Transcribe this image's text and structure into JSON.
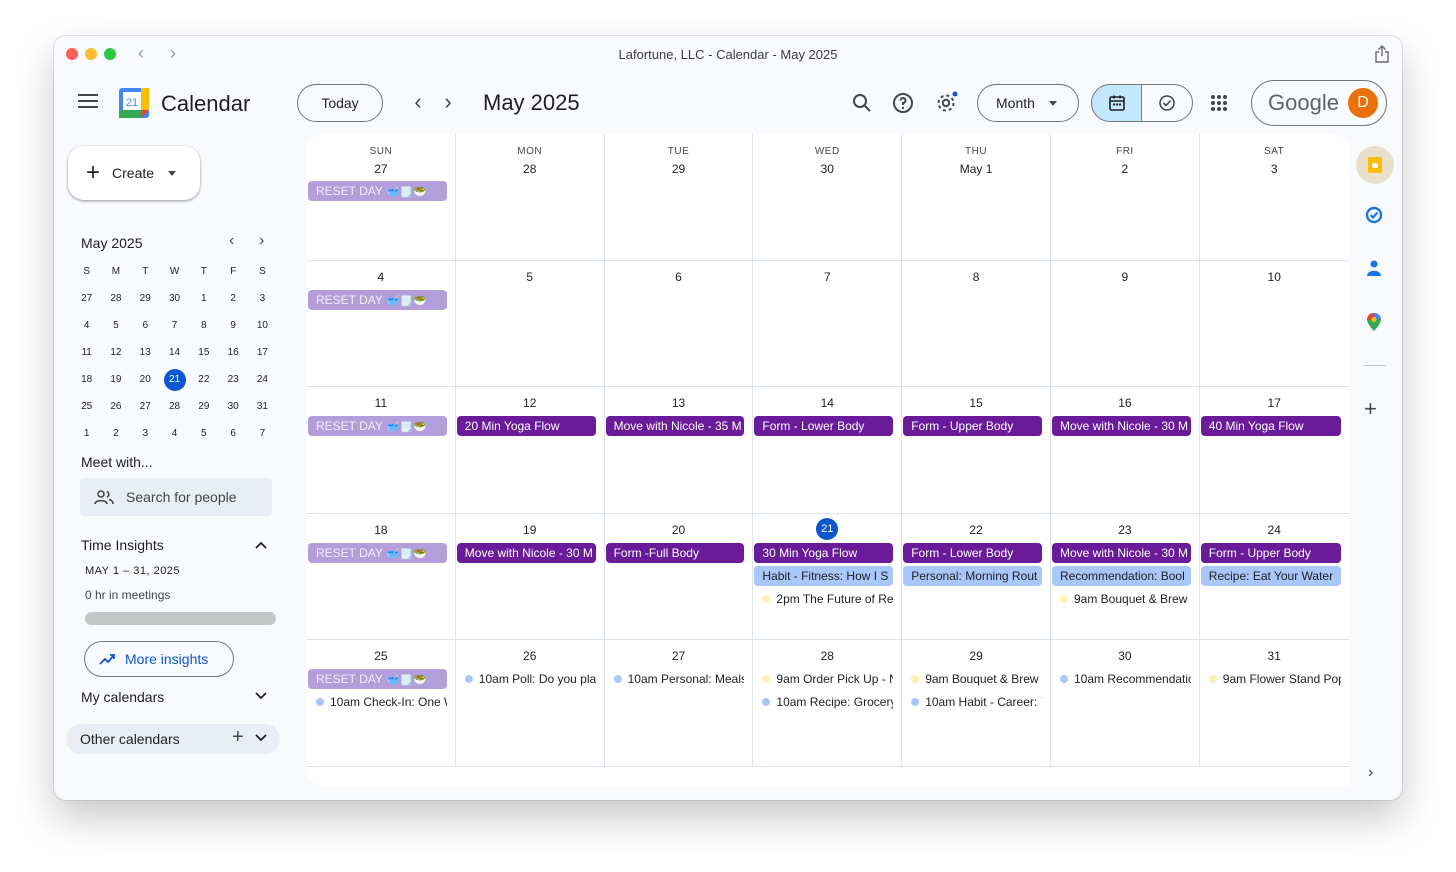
{
  "window": {
    "title": "Lafortune, LLC - Calendar - May 2025"
  },
  "header": {
    "app_name": "Calendar",
    "logo_day": "21",
    "today_label": "Today",
    "period_label": "May 2025",
    "view_label": "Month",
    "brand_word": "Google",
    "avatar_initial": "D"
  },
  "sidebar": {
    "create_label": "Create",
    "mini_cal": {
      "title": "May 2025",
      "weekday_headers": [
        "S",
        "M",
        "T",
        "W",
        "T",
        "F",
        "S"
      ],
      "days": [
        "27",
        "28",
        "29",
        "30",
        "1",
        "2",
        "3",
        "4",
        "5",
        "6",
        "7",
        "8",
        "9",
        "10",
        "11",
        "12",
        "13",
        "14",
        "15",
        "16",
        "17",
        "18",
        "19",
        "20",
        "21",
        "22",
        "23",
        "24",
        "25",
        "26",
        "27",
        "28",
        "29",
        "30",
        "31",
        "1",
        "2",
        "3",
        "4",
        "5",
        "6",
        "7"
      ],
      "today_value": "21"
    },
    "meet_title": "Meet with...",
    "search_people_label": "Search for people",
    "time_insights": {
      "title": "Time Insights",
      "range": "MAY 1 – 31, 2025",
      "meetings": "0 hr in meetings",
      "meeting_fraction": 0,
      "more_label": "More insights"
    },
    "my_calendars_label": "My calendars",
    "other_calendars_label": "Other calendars"
  },
  "colors": {
    "reset": "#b39ddb",
    "purple": "#6a1b9a",
    "blue": "#a8c7fa",
    "today": "#0b57d0",
    "dot_blue": "#a8c7fa",
    "dot_yellow": "#fff2b3"
  },
  "month": {
    "weekdays": [
      "SUN",
      "MON",
      "TUE",
      "WED",
      "THU",
      "FRI",
      "SAT"
    ],
    "weeks": [
      [
        {
          "day": "27",
          "events": [
            {
              "title": "RESET DAY",
              "style": "reset",
              "emoji": "🥣🗒️🥗"
            }
          ]
        },
        {
          "day": "28",
          "events": []
        },
        {
          "day": "29",
          "events": []
        },
        {
          "day": "30",
          "events": []
        },
        {
          "day": "May 1",
          "events": []
        },
        {
          "day": "2",
          "events": []
        },
        {
          "day": "3",
          "events": []
        }
      ],
      [
        {
          "day": "4",
          "events": [
            {
              "title": "RESET DAY",
              "style": "reset",
              "emoji": "🥣🗒️🥗"
            }
          ]
        },
        {
          "day": "5",
          "events": []
        },
        {
          "day": "6",
          "events": []
        },
        {
          "day": "7",
          "events": []
        },
        {
          "day": "8",
          "events": []
        },
        {
          "day": "9",
          "events": []
        },
        {
          "day": "10",
          "events": []
        }
      ],
      [
        {
          "day": "11",
          "events": [
            {
              "title": "RESET DAY",
              "style": "reset",
              "emoji": "🥣🗒️🥗"
            }
          ]
        },
        {
          "day": "12",
          "events": [
            {
              "title": "20 Min Yoga Flow",
              "style": "purple"
            }
          ]
        },
        {
          "day": "13",
          "events": [
            {
              "title": "Move with Nicole - 35 M",
              "style": "purple"
            }
          ]
        },
        {
          "day": "14",
          "events": [
            {
              "title": "Form - Lower Body",
              "style": "purple"
            }
          ]
        },
        {
          "day": "15",
          "events": [
            {
              "title": "Form - Upper Body",
              "style": "purple"
            }
          ]
        },
        {
          "day": "16",
          "events": [
            {
              "title": "Move with Nicole - 30 M",
              "style": "purple"
            }
          ]
        },
        {
          "day": "17",
          "events": [
            {
              "title": "40 Min Yoga Flow",
              "style": "purple"
            }
          ]
        }
      ],
      [
        {
          "day": "18",
          "events": [
            {
              "title": "RESET DAY",
              "style": "reset",
              "emoji": "🥣🗒️🥗"
            }
          ]
        },
        {
          "day": "19",
          "events": [
            {
              "title": "Move with Nicole - 30 M",
              "style": "purple"
            }
          ]
        },
        {
          "day": "20",
          "events": [
            {
              "title": "Form -Full Body",
              "style": "purple"
            }
          ]
        },
        {
          "day": "21",
          "today": true,
          "events": [
            {
              "title": "30 Min Yoga Flow",
              "style": "purple"
            },
            {
              "title": "Habit - Fitness: How I S",
              "style": "blue"
            },
            {
              "title": "2pm The Future of Ret",
              "style": "dot",
              "dot": "yellow"
            }
          ]
        },
        {
          "day": "22",
          "events": [
            {
              "title": "Form - Lower Body",
              "style": "purple"
            },
            {
              "title": "Personal: Morning Rout",
              "style": "blue"
            }
          ]
        },
        {
          "day": "23",
          "events": [
            {
              "title": "Move with Nicole - 30 M",
              "style": "purple"
            },
            {
              "title": "Recommendation: Bool",
              "style": "blue"
            },
            {
              "title": "9am Bouquet & Brew",
              "style": "dot",
              "dot": "yellow"
            }
          ]
        },
        {
          "day": "24",
          "events": [
            {
              "title": "Form - Upper Body",
              "style": "purple"
            },
            {
              "title": "Recipe: Eat Your Water",
              "style": "blue"
            }
          ]
        }
      ],
      [
        {
          "day": "25",
          "events": [
            {
              "title": "RESET DAY",
              "style": "reset",
              "emoji": "🥣🗒️🥗"
            },
            {
              "title": "10am Check-In: One W",
              "style": "dot",
              "dot": "blue"
            }
          ]
        },
        {
          "day": "26",
          "events": [
            {
              "title": "10am Poll: Do you plar",
              "style": "dot",
              "dot": "blue"
            }
          ]
        },
        {
          "day": "27",
          "events": [
            {
              "title": "10am Personal: Meals",
              "style": "dot",
              "dot": "blue"
            }
          ]
        },
        {
          "day": "28",
          "events": [
            {
              "title": "9am Order Pick Up - N",
              "style": "dot",
              "dot": "yellow"
            },
            {
              "title": "10am Recipe: Grocery",
              "style": "dot",
              "dot": "blue"
            }
          ]
        },
        {
          "day": "29",
          "events": [
            {
              "title": "9am Bouquet & Brew",
              "style": "dot",
              "dot": "yellow"
            },
            {
              "title": "10am Habit - Career: `",
              "style": "dot",
              "dot": "blue"
            }
          ]
        },
        {
          "day": "30",
          "events": [
            {
              "title": "10am Recommendatic",
              "style": "dot",
              "dot": "blue"
            }
          ]
        },
        {
          "day": "31",
          "events": [
            {
              "title": "9am Flower Stand Pop",
              "style": "dot",
              "dot": "yellow"
            }
          ]
        }
      ]
    ]
  },
  "right_rail": {
    "icons": [
      "keep-icon",
      "tasks-icon",
      "contacts-icon",
      "maps-icon"
    ]
  }
}
